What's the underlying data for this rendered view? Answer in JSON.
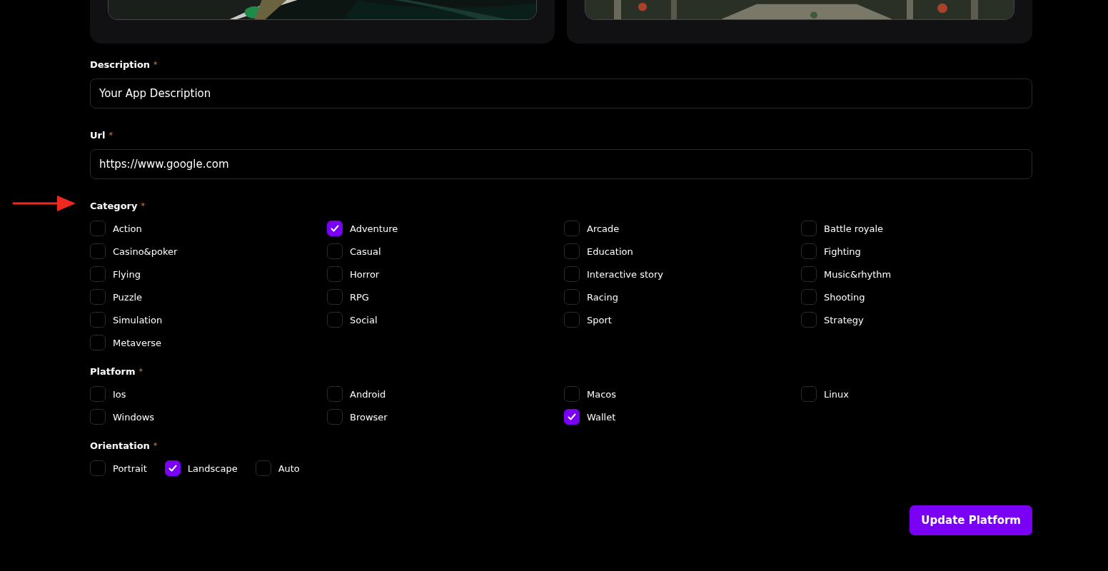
{
  "fields": [
    {
      "label": "Description",
      "marker": "*",
      "value": "Your App Description"
    },
    {
      "label": "Url",
      "marker": "*",
      "value": "https://www.google.com"
    }
  ],
  "groups": [
    {
      "label": "Category",
      "marker": "*",
      "kind": "grid",
      "annotated": true,
      "options": [
        {
          "label": "Action",
          "checked": false
        },
        {
          "label": "Adventure",
          "checked": true
        },
        {
          "label": "Arcade",
          "checked": false
        },
        {
          "label": "Battle royale",
          "checked": false
        },
        {
          "label": "Casino&poker",
          "checked": false
        },
        {
          "label": "Casual",
          "checked": false
        },
        {
          "label": "Education",
          "checked": false
        },
        {
          "label": "Fighting",
          "checked": false
        },
        {
          "label": "Flying",
          "checked": false
        },
        {
          "label": "Horror",
          "checked": false
        },
        {
          "label": "Interactive story",
          "checked": false
        },
        {
          "label": "Music&rhythm",
          "checked": false
        },
        {
          "label": "Puzzle",
          "checked": false
        },
        {
          "label": "RPG",
          "checked": false
        },
        {
          "label": "Racing",
          "checked": false
        },
        {
          "label": "Shooting",
          "checked": false
        },
        {
          "label": "Simulation",
          "checked": false
        },
        {
          "label": "Social",
          "checked": false
        },
        {
          "label": "Sport",
          "checked": false
        },
        {
          "label": "Strategy",
          "checked": false
        },
        {
          "label": "Metaverse",
          "checked": false
        }
      ]
    },
    {
      "label": "Platform",
      "marker": "*",
      "kind": "grid",
      "annotated": false,
      "options": [
        {
          "label": "Ios",
          "checked": false
        },
        {
          "label": "Android",
          "checked": false
        },
        {
          "label": "Macos",
          "checked": false
        },
        {
          "label": "Linux",
          "checked": false
        },
        {
          "label": "Windows",
          "checked": false
        },
        {
          "label": "Browser",
          "checked": false
        },
        {
          "label": "Wallet",
          "checked": true
        }
      ]
    },
    {
      "label": "Orientation",
      "marker": "*",
      "kind": "inline",
      "annotated": false,
      "options": [
        {
          "label": "Portrait",
          "checked": false
        },
        {
          "label": "Landscape",
          "checked": true
        },
        {
          "label": "Auto",
          "checked": false
        }
      ]
    }
  ],
  "submit": {
    "label": "Update Platform"
  }
}
